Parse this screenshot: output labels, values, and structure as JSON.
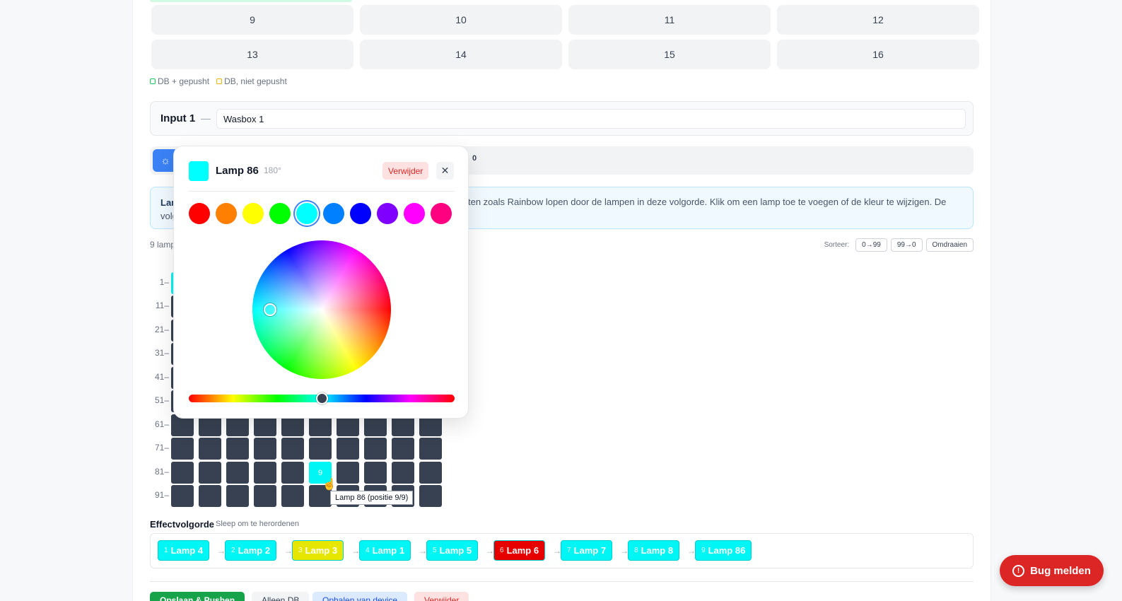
{
  "input_grid": {
    "row1": [
      "9",
      "10",
      "11",
      "12"
    ],
    "row2": [
      "13",
      "14",
      "15",
      "16"
    ]
  },
  "legend": {
    "pushed": "DB + gepusht",
    "not_pushed": "DB, niet gepusht"
  },
  "input_card": {
    "label": "Input 1",
    "dash": "—",
    "name_value": "Wasbox 1"
  },
  "tabs": {
    "count": "0"
  },
  "info": {
    "title_prefix": "Lan",
    "line2_prefix": "volg",
    "text": "ten zoals Rainbow lopen door de lampen in deze volgorde. Klik om een lamp toe te voegen of de kleur te wijzigen. De"
  },
  "lamp_count_label": "9 lamp",
  "sort": {
    "label": "Sorteer:",
    "asc": "0→99",
    "desc": "99→0",
    "reverse": "Omdraaien"
  },
  "grid_rows": [
    "1–",
    "11–",
    "21–",
    "31–",
    "41–",
    "51–",
    "61–",
    "71–",
    "81–",
    "91–"
  ],
  "active_cell": "9",
  "tooltip": "Lamp 86 (positie 9/9)",
  "effect": {
    "title": "Effectvolgorde",
    "subtitle": "Sleep om te herordenen",
    "chips": [
      {
        "num": "1",
        "label": "Lamp 4",
        "color": "#00f5f5"
      },
      {
        "num": "2",
        "label": "Lamp 2",
        "color": "#00f5f5"
      },
      {
        "num": "3",
        "label": "Lamp 3",
        "color": "#e6e600"
      },
      {
        "num": "4",
        "label": "Lamp 1",
        "color": "#00f5f5"
      },
      {
        "num": "5",
        "label": "Lamp 5",
        "color": "#00f5f5"
      },
      {
        "num": "6",
        "label": "Lamp 6",
        "color": "#e60000"
      },
      {
        "num": "7",
        "label": "Lamp 7",
        "color": "#00f5f5"
      },
      {
        "num": "8",
        "label": "Lamp 8",
        "color": "#00f5f5"
      },
      {
        "num": "9",
        "label": "Lamp 86",
        "color": "#00f5f5"
      }
    ]
  },
  "bottom_buttons": [
    "Opslaan & Pushen",
    "Alleen DB",
    "Ophalen van device",
    "Verwijder"
  ],
  "bug_button": "Bug melden",
  "popover": {
    "lamp_name": "Lamp 86",
    "hue": "180°",
    "delete": "Verwijder",
    "close": "✕",
    "swatch_color": "#00ffff",
    "presets": [
      "#ff0000",
      "#ff8000",
      "#ffff00",
      "#00ff00",
      "#00ffff",
      "#0080ff",
      "#0000ff",
      "#8000ff",
      "#ff00ff",
      "#ff0080"
    ],
    "selected_preset": 4,
    "hue_value": 180
  }
}
